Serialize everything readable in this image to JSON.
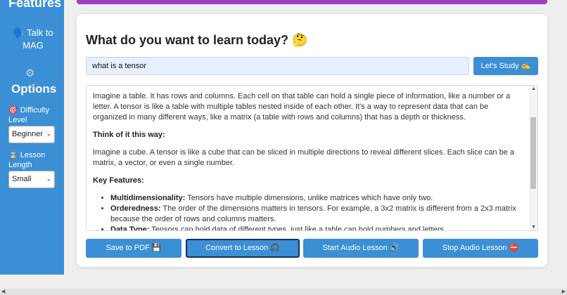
{
  "sidebar": {
    "features_label": "Features",
    "talk_label": "🗣️ Talk to MAG",
    "options_label": "Options",
    "difficulty_label": "🎯 Difficulty Level",
    "difficulty_value": "Beginner",
    "length_label": "⌛ Lesson Length",
    "length_value": "Small"
  },
  "main": {
    "title": "What do you want to learn today? 🤔",
    "search_value": "what is a tensor",
    "study_button": "Let's Study ✍️",
    "content": {
      "p1": "Imagine a table. It has rows and columns. Each cell on that table can hold a single piece of information, like a number or a letter. A tensor is like a table with multiple tables nested inside of each other. It's a way to represent data that can be organized in many different ways, like a matrix (a table with rows and columns) that has a depth or thickness.",
      "h1": "Think of it this way:",
      "p2": "Imagine a cube. A tensor is like a cube that can be sliced in multiple directions to reveal different slices. Each slice can be a matrix, a vector, or even a single number.",
      "h2": "Key Features:",
      "list": [
        {
          "term": "Multidimensionality:",
          "text": " Tensors have multiple dimensions, unlike matrices which have only two."
        },
        {
          "term": "Orderedness:",
          "text": " The order of the dimensions matters in tensors. For example, a 3x2 matrix is different from a 2x3 matrix because the order of rows and columns matters."
        },
        {
          "term": "Data Type:",
          "text": " Tensors can hold data of different types, just like a table can hold numbers and letters."
        }
      ]
    },
    "actions": {
      "save_pdf": "Save to PDF 💾",
      "convert": "Convert to Lesson 🎧",
      "start_audio": "Start Audio Lesson 🔊",
      "stop_audio": "Stop Audio Lesson ⛔"
    }
  },
  "colors": {
    "primary": "#3b8fd4",
    "accent_bar": "#9b3fc1"
  }
}
